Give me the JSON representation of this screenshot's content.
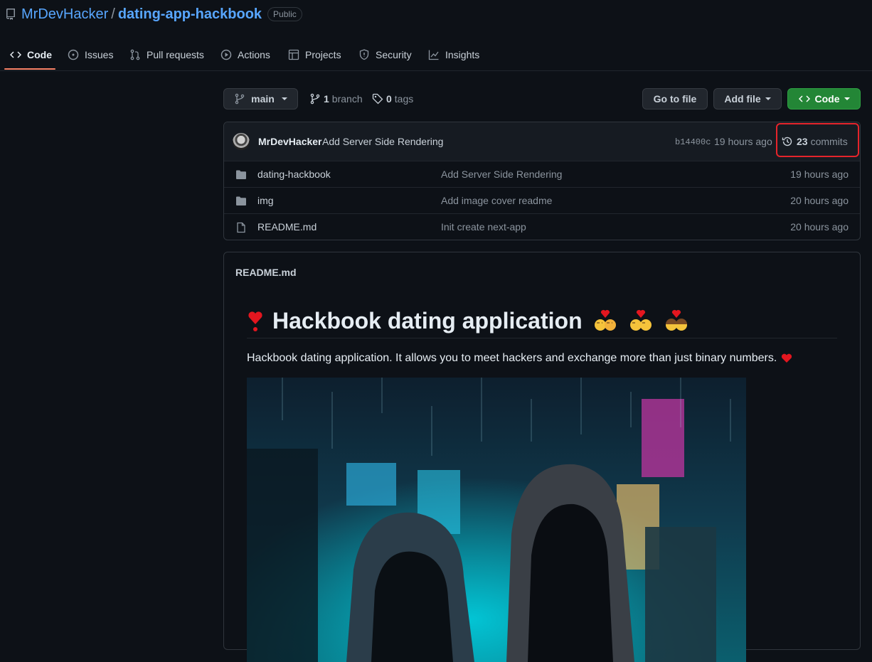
{
  "repo": {
    "owner": "MrDevHacker",
    "separator": "/",
    "name": "dating-app-hackbook",
    "visibility": "Public"
  },
  "tabs": [
    {
      "label": "Code",
      "icon": "code-icon",
      "active": true
    },
    {
      "label": "Issues",
      "icon": "issue-icon"
    },
    {
      "label": "Pull requests",
      "icon": "pull-request-icon"
    },
    {
      "label": "Actions",
      "icon": "play-icon"
    },
    {
      "label": "Projects",
      "icon": "table-icon"
    },
    {
      "label": "Security",
      "icon": "shield-icon"
    },
    {
      "label": "Insights",
      "icon": "graph-icon"
    }
  ],
  "filenav": {
    "branch": "main",
    "branch_count": "1",
    "branch_label": "branch",
    "tag_count": "0",
    "tag_label": "tags",
    "go_to_file": "Go to file",
    "add_file": "Add file",
    "code": "Code"
  },
  "latest_commit": {
    "author": "MrDevHacker",
    "message": "Add Server Side Rendering",
    "sha": "b14400c",
    "time": "19 hours ago",
    "commit_count": "23",
    "commit_label": "commits"
  },
  "files": [
    {
      "type": "folder",
      "name": "dating-hackbook",
      "message": "Add Server Side Rendering",
      "time": "19 hours ago"
    },
    {
      "type": "folder",
      "name": "img",
      "message": "Add image cover readme",
      "time": "20 hours ago"
    },
    {
      "type": "file",
      "name": "README.md",
      "message": "Init create next-app",
      "time": "20 hours ago"
    }
  ],
  "readme": {
    "file_label": "README.md",
    "heading": "Hackbook dating application",
    "paragraph": "Hackbook dating application. It allows you to meet hackers and exchange more than just binary numbers."
  },
  "colors": {
    "background": "#0d1117",
    "link": "#58a6ff",
    "green_button": "#238636",
    "highlight_box": "#e5242b",
    "tab_underline": "#f78166"
  }
}
